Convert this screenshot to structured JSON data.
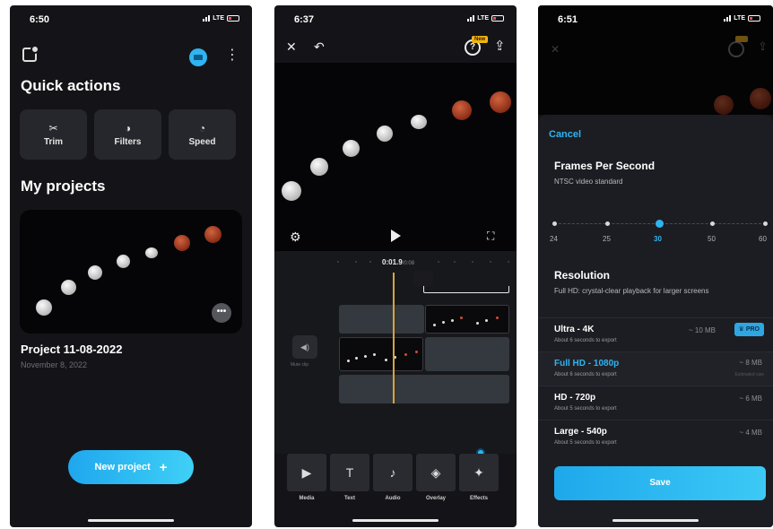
{
  "screen1": {
    "status_time": "6:50",
    "status_network": "LTE",
    "quick_actions_title": "Quick actions",
    "quick_actions": [
      {
        "label": "Trim",
        "icon": "scissors-icon"
      },
      {
        "label": "Filters",
        "icon": "filters-icon"
      },
      {
        "label": "Speed",
        "icon": "speedometer-icon"
      }
    ],
    "my_projects_title": "My projects",
    "project": {
      "title": "Project 11-08-2022",
      "date": "November 8, 2022",
      "more": "•••"
    },
    "new_project_label": "New project",
    "new_project_icon": "+",
    "accent": "#2fb4f2"
  },
  "screen2": {
    "status_time": "6:37",
    "status_network": "LTE",
    "new_badge": "New",
    "help_icon": "?",
    "timecode": "0:01.9",
    "timecode_total": "/0:08",
    "mute_label": "Mute clip",
    "tools": [
      {
        "label": "Media",
        "icon": "media-icon",
        "glyph": "▶"
      },
      {
        "label": "Text",
        "icon": "text-icon",
        "glyph": "T"
      },
      {
        "label": "Audio",
        "icon": "music-note-icon",
        "glyph": "♪"
      },
      {
        "label": "Overlay",
        "icon": "layers-icon",
        "glyph": "◈"
      },
      {
        "label": "Effects",
        "icon": "magic-wand-icon",
        "glyph": "✦"
      }
    ],
    "playhead_color": "#d8a43c"
  },
  "screen3": {
    "status_time": "6:51",
    "status_network": "LTE",
    "cancel_label": "Cancel",
    "fps_title": "Frames Per Second",
    "fps_subtitle": "NTSC video standard",
    "fps_options": [
      "24",
      "25",
      "30",
      "50",
      "60"
    ],
    "fps_selected": "30",
    "resolution_title": "Resolution",
    "resolution_subtitle": "Full HD: crystal-clear playback for larger screens",
    "resolutions": [
      {
        "name": "Ultra - 4K",
        "sub": "About 6 seconds to export",
        "size": "~ 10 MB",
        "pro": "PRO"
      },
      {
        "name": "Full HD - 1080p",
        "sub": "About 6 seconds to export",
        "size": "~ 8 MB",
        "note": "Estimated size"
      },
      {
        "name": "HD - 720p",
        "sub": "About 5 seconds to export",
        "size": "~ 6 MB"
      },
      {
        "name": "Large - 540p",
        "sub": "About 5 seconds to export",
        "size": "~ 4 MB"
      }
    ],
    "resolution_selected": "Full HD - 1080p",
    "save_label": "Save"
  }
}
